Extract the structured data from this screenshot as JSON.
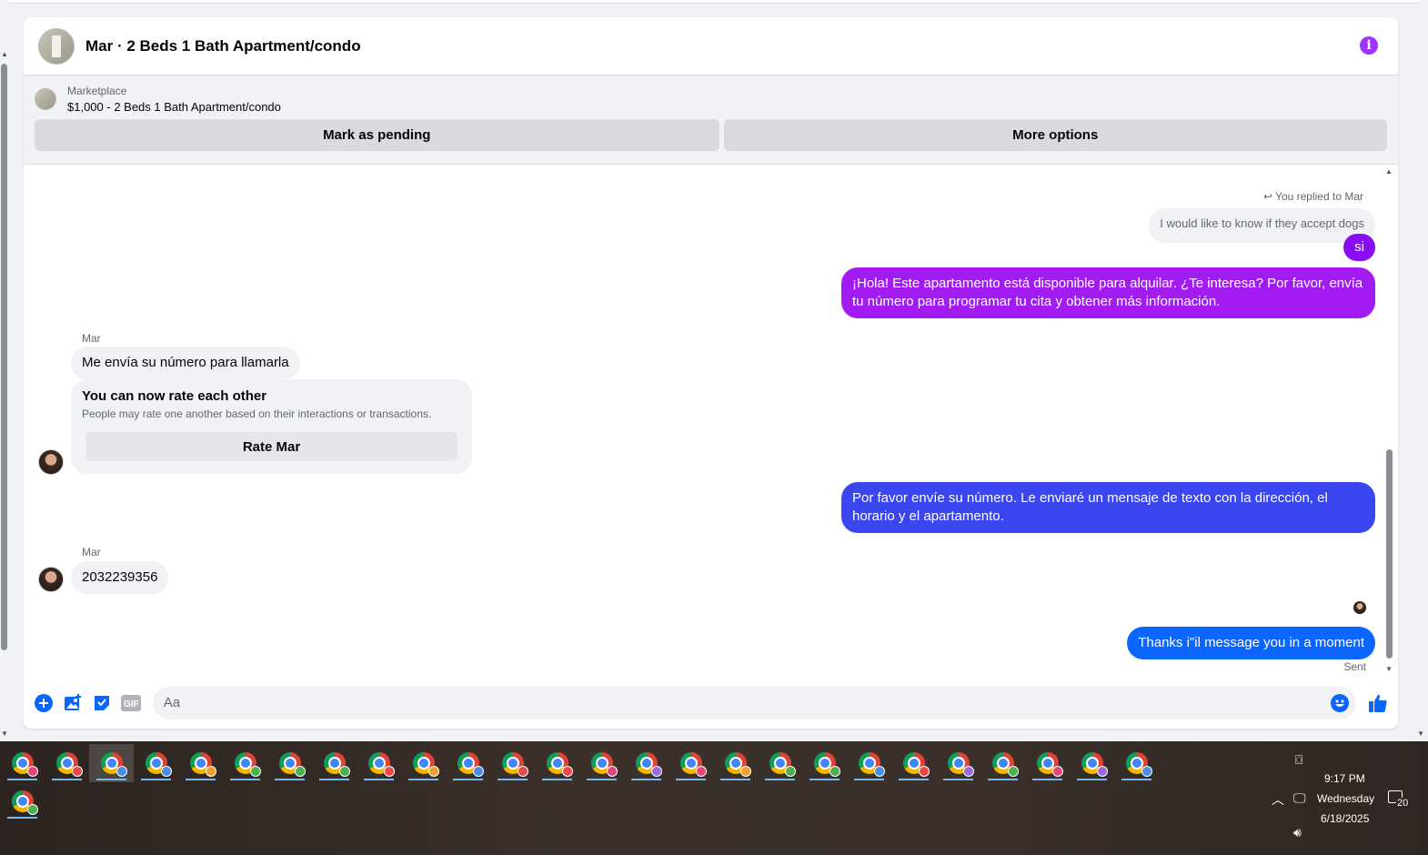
{
  "header": {
    "title": "Mar · 2 Beds 1 Bath Apartment/condo"
  },
  "marketplace": {
    "label": "Marketplace",
    "listing": "$1,000 - 2 Beds 1 Bath Apartment/condo",
    "pending_label": "Mark as pending",
    "more_label": "More options"
  },
  "messages": {
    "replied_to": "You replied to Mar",
    "quoted": "I would like to know if they accept dogs",
    "reply_si": "si",
    "outgoing_1": "¡Hola! Este apartamento está disponible para alquilar. ¿Te interesa? Por favor, envía tu número para programar tu cita y obtener más información.",
    "sender_name_1": "Mar",
    "incoming_1": "Me envía su número para llamarla",
    "rate_title": "You can now rate each other",
    "rate_sub": "People may rate one another based on their interactions or transactions.",
    "rate_button": "Rate Mar",
    "outgoing_2": "Por favor envíe su número. Le enviaré un mensaje de texto con la dirección, el horario y el apartamento.",
    "sender_name_2": "Mar",
    "incoming_2": "2032239356",
    "outgoing_3": "Thanks i\"il message you in a moment",
    "status": "Sent"
  },
  "composer": {
    "placeholder": "Aa"
  },
  "taskbar": {
    "time": "9:17 PM",
    "day": "Wednesday",
    "date": "6/18/2025",
    "notification_count": "20",
    "profile_colors": [
      "#e0457b",
      "#e94b4b",
      "#4a8fe7",
      "#4a8fe7",
      "#f0a030",
      "#4caf50",
      "#4caf50",
      "#4caf50",
      "#e94b4b",
      "#f0a030",
      "#4a8fe7",
      "#e94b4b",
      "#e94b4b",
      "#e0457b",
      "#9c6ade",
      "#e0457b",
      "#f0a030",
      "#4caf50",
      "#4caf50",
      "#4a8fe7",
      "#e94b4b",
      "#9c6ade",
      "#4caf50",
      "#e0457b",
      "#9c6ade",
      "#4a8fe7"
    ],
    "second_row_color": "#4caf50"
  },
  "colors": {
    "accent_blue": "#0a66ff",
    "purple": "#8a0df5",
    "info_icon": "#a033ff"
  }
}
